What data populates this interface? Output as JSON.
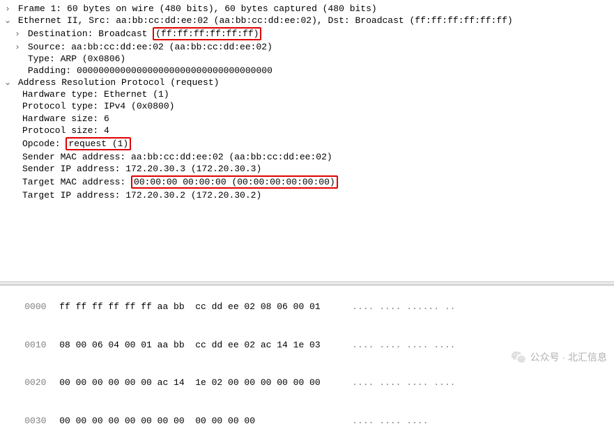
{
  "details": {
    "frame": "Frame 1: 60 bytes on wire (480 bits), 60 bytes captured (480 bits)",
    "ethernet_header": "Ethernet II, Src: aa:bb:cc:dd:ee:02 (aa:bb:cc:dd:ee:02), Dst: Broadcast (ff:ff:ff:ff:ff:ff)",
    "dest_label": "Destination: Broadcast ",
    "dest_value": "(ff:ff:ff:ff:ff:ff)",
    "source": "Source: aa:bb:cc:dd:ee:02 (aa:bb:cc:dd:ee:02)",
    "type": "Type: ARP (0x0806)",
    "padding": "Padding: 000000000000000000000000000000000000",
    "arp_header": "Address Resolution Protocol (request)",
    "hw_type": "Hardware type: Ethernet (1)",
    "proto_type": "Protocol type: IPv4 (0x0800)",
    "hw_size": "Hardware size: 6",
    "proto_size": "Protocol size: 4",
    "opcode_label": "Opcode: ",
    "opcode_value": "request (1)",
    "sender_mac": "Sender MAC address: aa:bb:cc:dd:ee:02 (aa:bb:cc:dd:ee:02)",
    "sender_ip": "Sender IP address: 172.20.30.3 (172.20.30.3)",
    "target_mac_label": "Target MAC address: ",
    "target_mac_value": "00:00:00 00:00:00 (00:00:00:00:00:00)",
    "target_ip": "Target IP address: 172.20.30.2 (172.20.30.2)"
  },
  "hex": {
    "rows": [
      {
        "offset": "0000",
        "b1": "ff ff ff ff ff ff aa bb",
        "b2": "cc dd ee 02 08 06 00 01",
        "ascii": ".... .... ...... .."
      },
      {
        "offset": "0010",
        "b1": "08 00 06 04 00 01 aa bb",
        "b2": "cc dd ee 02 ac 14 1e 03",
        "ascii": ".... .... .... ...."
      },
      {
        "offset": "0020",
        "b1": "00 00 00 00 00 00 ac 14",
        "b2": "1e 02 00 00 00 00 00 00",
        "ascii": ".... .... .... ...."
      },
      {
        "offset": "0030",
        "b1": "00 00 00 00 00 00 00 00",
        "b2": "00 00 00 00",
        "ascii": ".... .... ...."
      }
    ]
  },
  "watermark": {
    "text": "公众号 · 北汇信息"
  },
  "icons": {
    "collapsed": "›",
    "expanded": "⌄"
  }
}
